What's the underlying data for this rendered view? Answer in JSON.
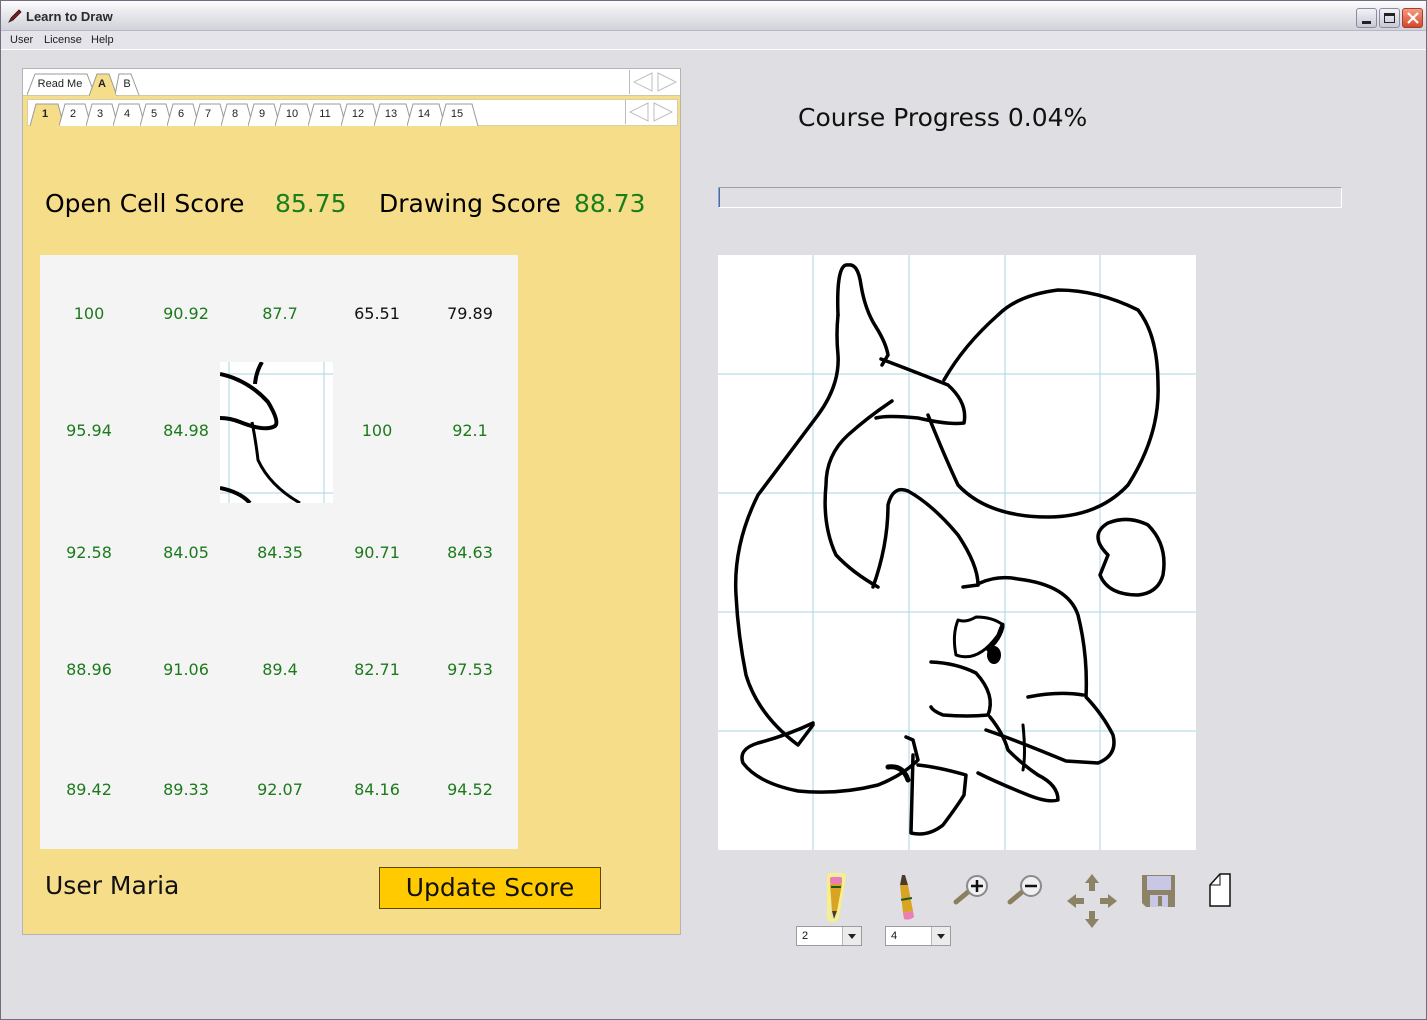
{
  "window": {
    "title": "Learn to Draw",
    "controls": [
      "minimize",
      "maximize",
      "close"
    ]
  },
  "menubar": {
    "items": [
      {
        "label": "User"
      },
      {
        "label": "License"
      },
      {
        "label": "Help"
      }
    ]
  },
  "outer_tabs": {
    "items": [
      {
        "label": "Read Me",
        "active": false
      },
      {
        "label": "A",
        "active": true
      },
      {
        "label": "B",
        "active": false
      }
    ]
  },
  "inner_tabs": {
    "items": [
      {
        "label": "1",
        "active": true
      },
      {
        "label": "2"
      },
      {
        "label": "3"
      },
      {
        "label": "4"
      },
      {
        "label": "5"
      },
      {
        "label": "6"
      },
      {
        "label": "7"
      },
      {
        "label": "8"
      },
      {
        "label": "9"
      },
      {
        "label": "10"
      },
      {
        "label": "11"
      },
      {
        "label": "12"
      },
      {
        "label": "13"
      },
      {
        "label": "14"
      },
      {
        "label": "15"
      }
    ]
  },
  "scores": {
    "open_cell_label": "Open Cell Score",
    "open_cell_value": "85.75",
    "drawing_label": "Drawing Score",
    "drawing_value": "88.73"
  },
  "cell_grid": {
    "rows": [
      [
        {
          "v": "100",
          "c": "green"
        },
        {
          "v": "90.92",
          "c": "green"
        },
        {
          "v": "87.7",
          "c": "green"
        },
        {
          "v": "65.51",
          "c": "black"
        },
        {
          "v": "79.89",
          "c": "black"
        }
      ],
      [
        {
          "v": "95.94",
          "c": "green"
        },
        {
          "v": "84.98",
          "c": "green"
        },
        {
          "v": null,
          "c": "open"
        },
        {
          "v": "100",
          "c": "green"
        },
        {
          "v": "92.1",
          "c": "green"
        }
      ],
      [
        {
          "v": "92.58",
          "c": "green"
        },
        {
          "v": "84.05",
          "c": "green"
        },
        {
          "v": "84.35",
          "c": "green"
        },
        {
          "v": "90.71",
          "c": "green"
        },
        {
          "v": "84.63",
          "c": "green"
        }
      ],
      [
        {
          "v": "88.96",
          "c": "green"
        },
        {
          "v": "91.06",
          "c": "green"
        },
        {
          "v": "89.4",
          "c": "green"
        },
        {
          "v": "82.71",
          "c": "green"
        },
        {
          "v": "97.53",
          "c": "green"
        }
      ],
      [
        {
          "v": "89.42",
          "c": "green"
        },
        {
          "v": "89.33",
          "c": "green"
        },
        {
          "v": "92.07",
          "c": "green"
        },
        {
          "v": "84.16",
          "c": "green"
        },
        {
          "v": "94.52",
          "c": "green"
        }
      ]
    ]
  },
  "user": {
    "label": "User Maria"
  },
  "buttons": {
    "update_score": "Update Score"
  },
  "progress": {
    "label": "Course Progress 0.04%",
    "percent": 0.04
  },
  "toolbar": {
    "pencil_size": "2",
    "eraser_size": "4",
    "tools": [
      "pencil-icon",
      "eraser-icon",
      "zoom-in-icon",
      "zoom-out-icon",
      "move-icon",
      "save-icon",
      "new-page-icon"
    ]
  },
  "colors": {
    "panel_bg": "#f6dd8a",
    "score_green": "#1a7f1a",
    "button_yellow": "#ffcb00",
    "grid_line": "#a8d4e0"
  }
}
